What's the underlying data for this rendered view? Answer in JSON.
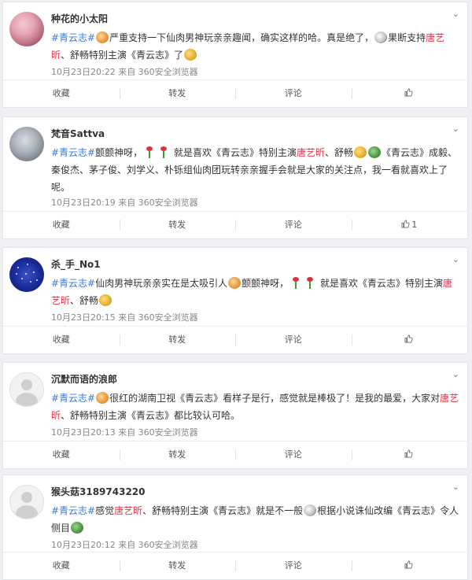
{
  "posts": [
    {
      "username": "种花的小太阳",
      "parts": [
        {
          "t": "link",
          "v": "#青云志#"
        },
        {
          "t": "emo",
          "v": "a"
        },
        {
          "t": "txt",
          "v": "严重支持一下仙肉男神玩亲亲趣闻，确实这样的哈。真是绝了，"
        },
        {
          "t": "emo",
          "v": "b"
        },
        {
          "t": "txt",
          "v": "果断支持"
        },
        {
          "t": "hl",
          "v": "唐艺昕"
        },
        {
          "t": "txt",
          "v": "、舒畅特别主演《青云志》了"
        },
        {
          "t": "emo",
          "v": "c"
        }
      ],
      "meta": "10月23日20:22 来自 360安全浏览器",
      "actions": {
        "fav": "收藏",
        "share": "转发",
        "comment": "评论",
        "like": ""
      }
    },
    {
      "username": "梵音Sattva",
      "parts": [
        {
          "t": "link",
          "v": "#青云志#"
        },
        {
          "t": "txt",
          "v": "颤颤神呀，"
        },
        {
          "t": "flower",
          "v": ""
        },
        {
          "t": "flower",
          "v": ""
        },
        {
          "t": "txt",
          "v": " 就是喜欢《青云志》特别主演"
        },
        {
          "t": "hl",
          "v": "唐艺昕"
        },
        {
          "t": "txt",
          "v": "、舒畅"
        },
        {
          "t": "emo",
          "v": "c"
        },
        {
          "t": "emo",
          "v": "g"
        },
        {
          "t": "txt",
          "v": "《青云志》成毅、秦俊杰、茅子俊、刘学义、朴铄组仙肉团玩转亲亲握手会就是大家的关注点，我一看就喜欢上了呢。"
        }
      ],
      "meta": "10月23日20:19 来自 360安全浏览器",
      "actions": {
        "fav": "收藏",
        "share": "转发",
        "comment": "评论",
        "like": "1"
      }
    },
    {
      "username": "杀_手_No1",
      "parts": [
        {
          "t": "link",
          "v": "#青云志#"
        },
        {
          "t": "txt",
          "v": "仙肉男神玩亲亲实在是太吸引人"
        },
        {
          "t": "emo",
          "v": "a"
        },
        {
          "t": "txt",
          "v": "颤颤神呀，"
        },
        {
          "t": "flower",
          "v": ""
        },
        {
          "t": "flower",
          "v": ""
        },
        {
          "t": "txt",
          "v": " 就是喜欢《青云志》特别主演"
        },
        {
          "t": "hl",
          "v": "唐艺昕"
        },
        {
          "t": "txt",
          "v": "、舒畅"
        },
        {
          "t": "emo",
          "v": "c"
        }
      ],
      "meta": "10月23日20:15 来自 360安全浏览器",
      "actions": {
        "fav": "收藏",
        "share": "转发",
        "comment": "评论",
        "like": ""
      }
    },
    {
      "username": "沉默而语的浪郎",
      "parts": [
        {
          "t": "link",
          "v": "#青云志#"
        },
        {
          "t": "emo",
          "v": "a"
        },
        {
          "t": "txt",
          "v": "很红的湖南卫视《青云志》看样子是行，感觉就是棒极了！是我的最爱，大家对"
        },
        {
          "t": "hl",
          "v": "唐艺昕"
        },
        {
          "t": "txt",
          "v": "、舒畅特别主演《青云志》都比较认可哈。"
        }
      ],
      "meta": "10月23日20:13 来自 360安全浏览器",
      "actions": {
        "fav": "收藏",
        "share": "转发",
        "comment": "评论",
        "like": ""
      }
    },
    {
      "username": "猴头菇3189743220",
      "parts": [
        {
          "t": "link",
          "v": "#青云志#"
        },
        {
          "t": "txt",
          "v": "感觉"
        },
        {
          "t": "hl",
          "v": "唐艺昕"
        },
        {
          "t": "txt",
          "v": "、舒畅特别主演《青云志》就是不一般"
        },
        {
          "t": "emo",
          "v": "b"
        },
        {
          "t": "txt",
          "v": "根据小说诛仙改编《青云志》令人侧目"
        },
        {
          "t": "emo",
          "v": "g"
        }
      ],
      "meta": "10月23日20:12 来自 360安全浏览器",
      "actions": {
        "fav": "收藏",
        "share": "转发",
        "comment": "评论",
        "like": ""
      }
    }
  ]
}
